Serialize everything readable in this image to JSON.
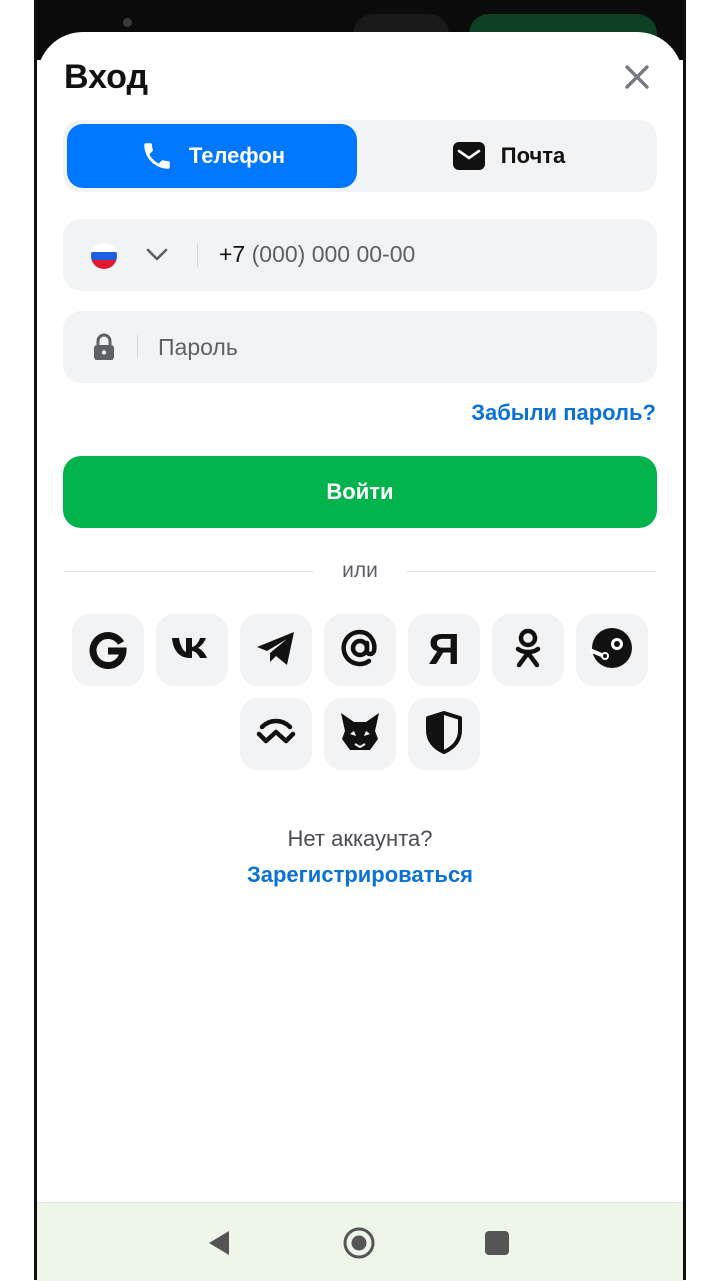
{
  "header": {
    "title": "Вход"
  },
  "tabs": [
    {
      "label": "Телефон",
      "icon": "phone-icon",
      "active": true
    },
    {
      "label": "Почта",
      "icon": "mail-icon",
      "active": false
    }
  ],
  "phone": {
    "country_flag": "ru-flag-icon",
    "prefix": "+7",
    "placeholder_rest": "(000) 000 00-00"
  },
  "password": {
    "placeholder": "Пароль",
    "value": ""
  },
  "forgot_label": "Забыли пароль?",
  "login_label": "Войти",
  "divider_label": "или",
  "social": [
    {
      "name": "google-icon",
      "label": "G"
    },
    {
      "name": "vk-icon"
    },
    {
      "name": "telegram-icon"
    },
    {
      "name": "mailru-icon",
      "label": "@"
    },
    {
      "name": "yandex-icon",
      "label": "Я"
    },
    {
      "name": "odnoklassniki-icon"
    },
    {
      "name": "steam-icon"
    },
    {
      "name": "walletconnect-icon"
    },
    {
      "name": "metamask-fox-icon"
    },
    {
      "name": "shield-icon"
    }
  ],
  "footer": {
    "no_account": "Нет аккаунта?",
    "register_label": "Зарегистрироваться"
  },
  "colors": {
    "accent": "#0077ff",
    "success": "#00b34c",
    "link": "#0a72d6"
  }
}
